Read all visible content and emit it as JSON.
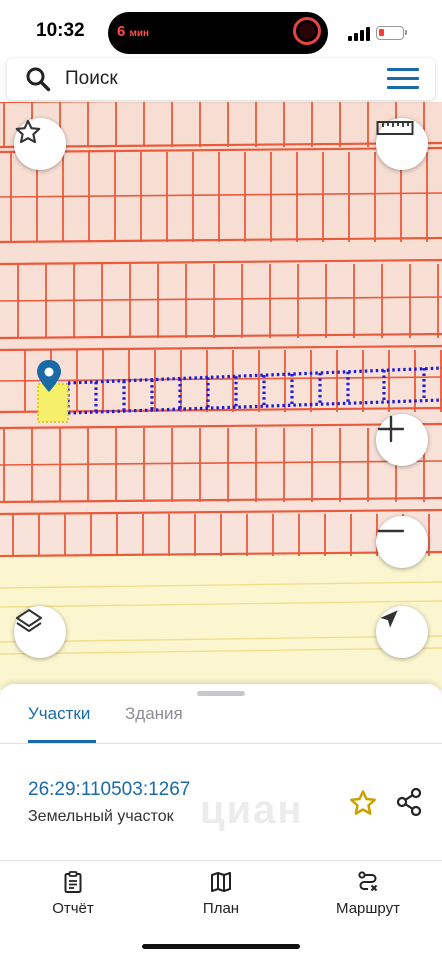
{
  "status_bar": {
    "time": "10:32",
    "activity_minutes": "6",
    "activity_unit": "мин",
    "battery_level": 0.2,
    "battery_color": "#ff3b30"
  },
  "search": {
    "placeholder": "Поиск",
    "icon": "search-icon",
    "menu_icon": "hamburger-menu-icon"
  },
  "map": {
    "parcel_fill_color": "#f5ef6a",
    "parcel_border_color": "#1d1dd8",
    "grid_color": "#ea5a3c",
    "buttons": {
      "favorite": "star-icon",
      "ruler": "ruler-icon",
      "zoom_in": "+",
      "zoom_out": "−",
      "layers": "layers-icon",
      "locate": "navigation-arrow-icon"
    }
  },
  "sheet": {
    "tabs": [
      {
        "label": "Участки",
        "active": true
      },
      {
        "label": "Здания",
        "active": false
      }
    ],
    "parcel": {
      "cadastral_number": "26:29:110503:1267",
      "type": "Земельный участок"
    },
    "watermark": "циан",
    "accent_color": "#1a6aa8",
    "star_color": "#c9a100"
  },
  "bottom_nav": [
    {
      "label": "Отчёт",
      "icon": "report-clipboard-icon"
    },
    {
      "label": "План",
      "icon": "map-plan-icon"
    },
    {
      "label": "Маршрут",
      "icon": "route-icon"
    }
  ]
}
